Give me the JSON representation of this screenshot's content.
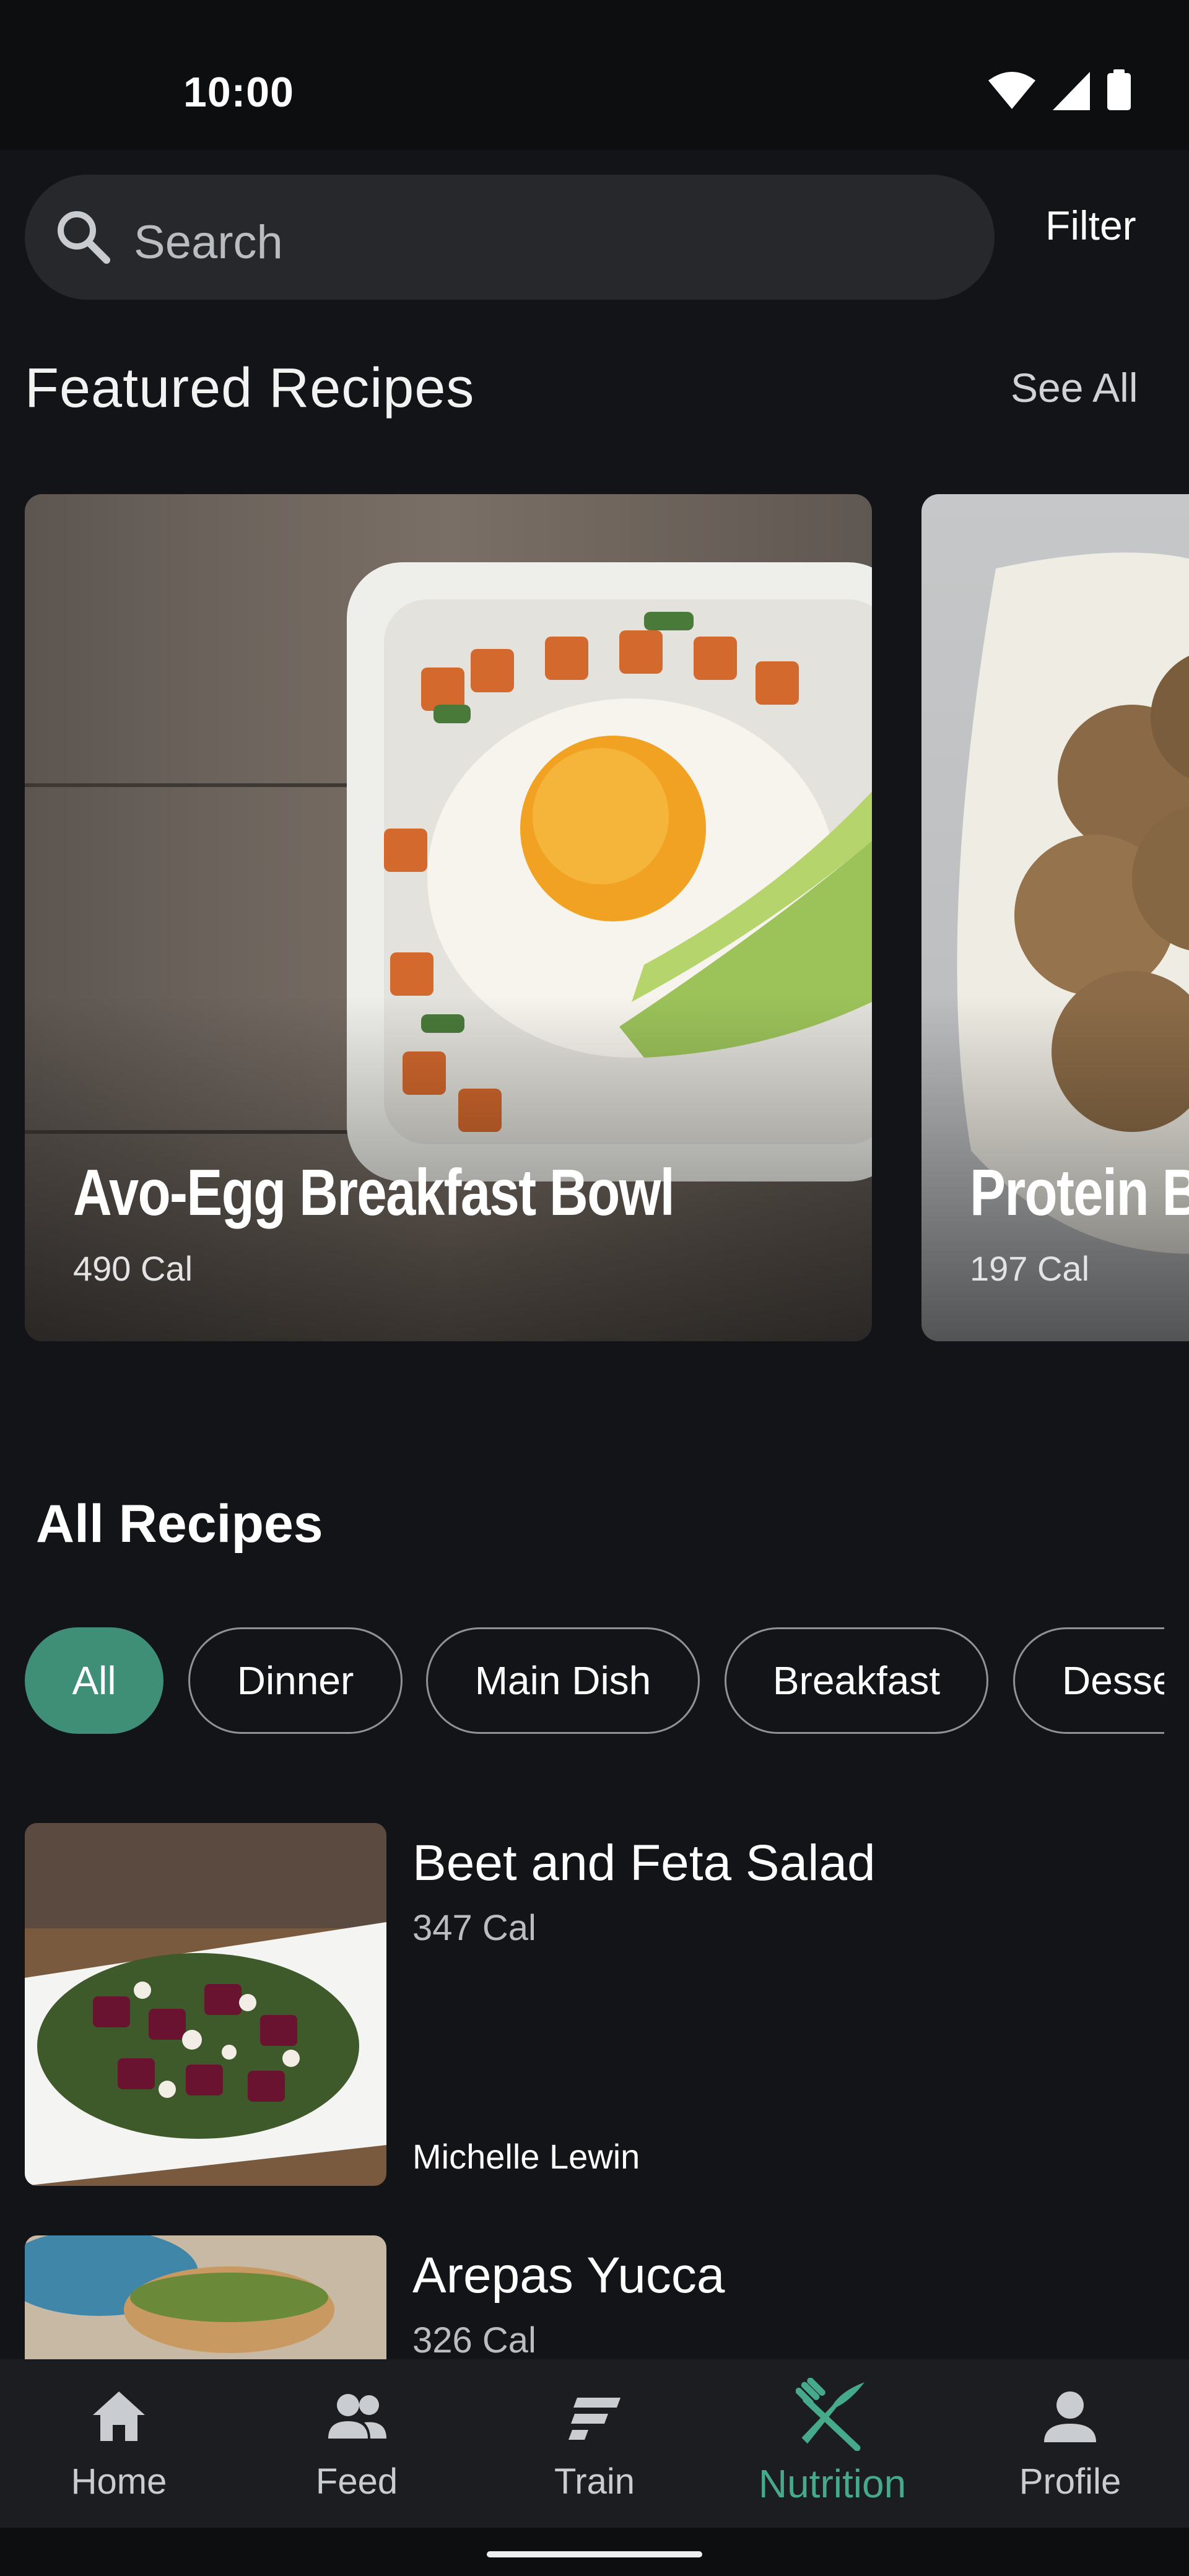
{
  "status_bar": {
    "time": "10:00"
  },
  "search": {
    "placeholder": "Search",
    "filter_label": "Filter"
  },
  "featured": {
    "title": "Featured Recipes",
    "see_all_label": "See All",
    "cards": [
      {
        "name": "Avo-Egg Breakfast Bowl",
        "calories": "490 Cal"
      },
      {
        "name": "Protein B",
        "calories": "197 Cal"
      }
    ]
  },
  "all_recipes": {
    "title": "All Recipes",
    "chips": [
      "All",
      "Dinner",
      "Main Dish",
      "Breakfast",
      "Desse"
    ],
    "active_chip": "All",
    "items": [
      {
        "name": "Beet and Feta Salad",
        "calories": "347 Cal",
        "author": "Michelle Lewin"
      },
      {
        "name": "Arepas Yucca",
        "calories": "326 Cal"
      }
    ]
  },
  "nav": {
    "items": [
      {
        "label": "Home",
        "icon": "home-icon"
      },
      {
        "label": "Feed",
        "icon": "people-icon"
      },
      {
        "label": "Train",
        "icon": "train-icon"
      },
      {
        "label": "Nutrition",
        "icon": "fork-knife-icon"
      },
      {
        "label": "Profile",
        "icon": "person-icon"
      }
    ],
    "active": "Nutrition"
  },
  "colors": {
    "accent": "#45a98a",
    "chip_active": "#3f8f76",
    "background": "#131417"
  }
}
